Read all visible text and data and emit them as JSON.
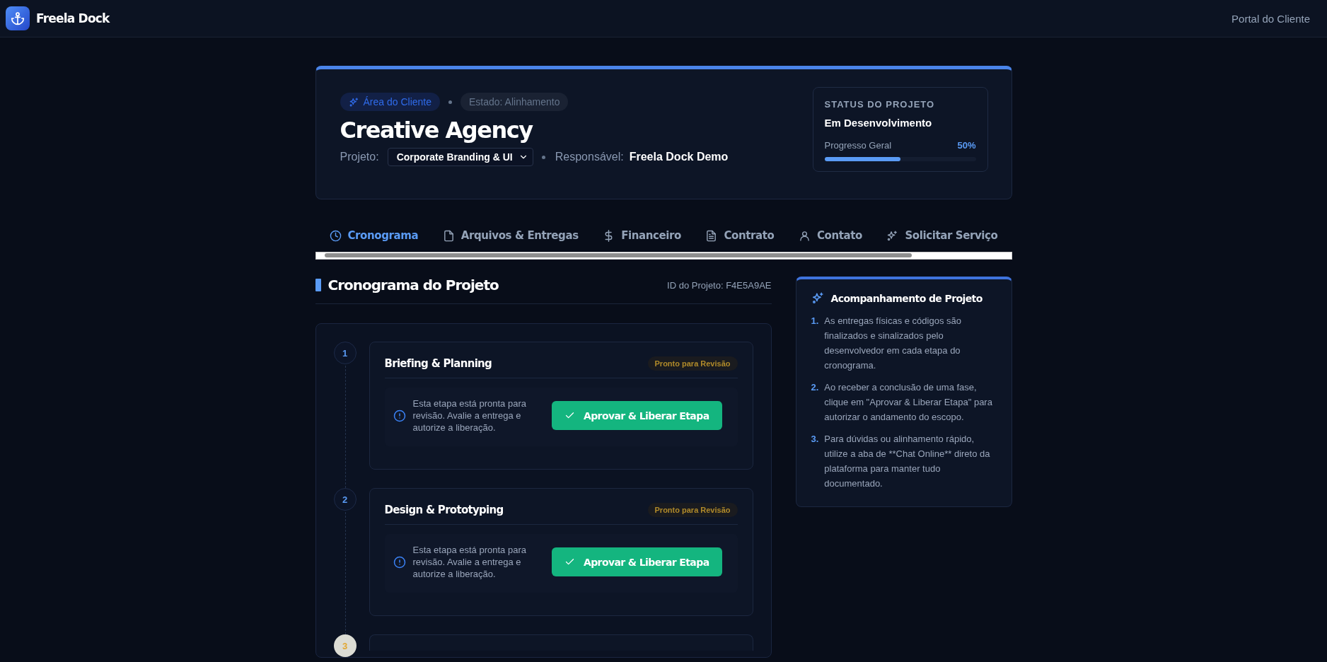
{
  "header": {
    "brand": "Freela Dock",
    "portal_link": "Portal do Cliente"
  },
  "project": {
    "badge": "Área do Cliente",
    "state_pill": "Estado: Alinhamento",
    "client_name": "Creative Agency",
    "project_label": "Projeto:",
    "project_select": "Corporate Branding & UI",
    "owner_label": "Responsável:",
    "owner_name": "Freela Dock Demo",
    "status": {
      "heading": "STATUS DO PROJETO",
      "value": "Em Desenvolvimento",
      "progress_label": "Progresso Geral",
      "progress_reading": "50%",
      "level": 0.5
    }
  },
  "tabs": [
    {
      "label": "Cronograma",
      "selected": true
    },
    {
      "label": "Arquivos & Entregas",
      "selected": false
    },
    {
      "label": "Financeiro",
      "selected": false
    },
    {
      "label": "Contrato",
      "selected": false
    },
    {
      "label": "Contato",
      "selected": false
    },
    {
      "label": "Solicitar Serviço",
      "selected": false
    }
  ],
  "timeline": {
    "title": "Cronograma do Projeto",
    "project_id": "ID do Projeto: F4E5A9AE",
    "steps": [
      {
        "number": "1",
        "kind": "review",
        "title": "Briefing & Planning",
        "status_badge": "Pronto para Revisão",
        "message": "Esta etapa está pronta para revisão. Avalie a entrega e autorize a liberação.",
        "action": "Aprovar & Liberar Etapa"
      },
      {
        "number": "2",
        "kind": "review",
        "title": "Design & Prototyping",
        "status_badge": "Pronto para Revisão",
        "message": "Esta etapa está pronta para revisão. Avalie a entrega e autorize a liberação.",
        "action": "Aprovar & Liberar Etapa"
      },
      {
        "number": "3",
        "kind": "pending"
      }
    ]
  },
  "guide": {
    "title": "Acompanhamento de Projeto",
    "items": [
      {
        "number": "1.",
        "text": "As entregas físicas e códigos são finalizados e sinalizados pelo desenvolvedor em cada etapa do cronograma."
      },
      {
        "number": "2.",
        "text": "Ao receber a conclusão de uma fase, clique em \"Aprovar & Liberar Etapa\" para autorizar o andamento do escopo."
      },
      {
        "number": "3.",
        "text": "Para dúvidas ou alinhamento rápido, utilize a aba de **Chat Online** direto da plataforma para manter tudo documentado."
      }
    ]
  }
}
